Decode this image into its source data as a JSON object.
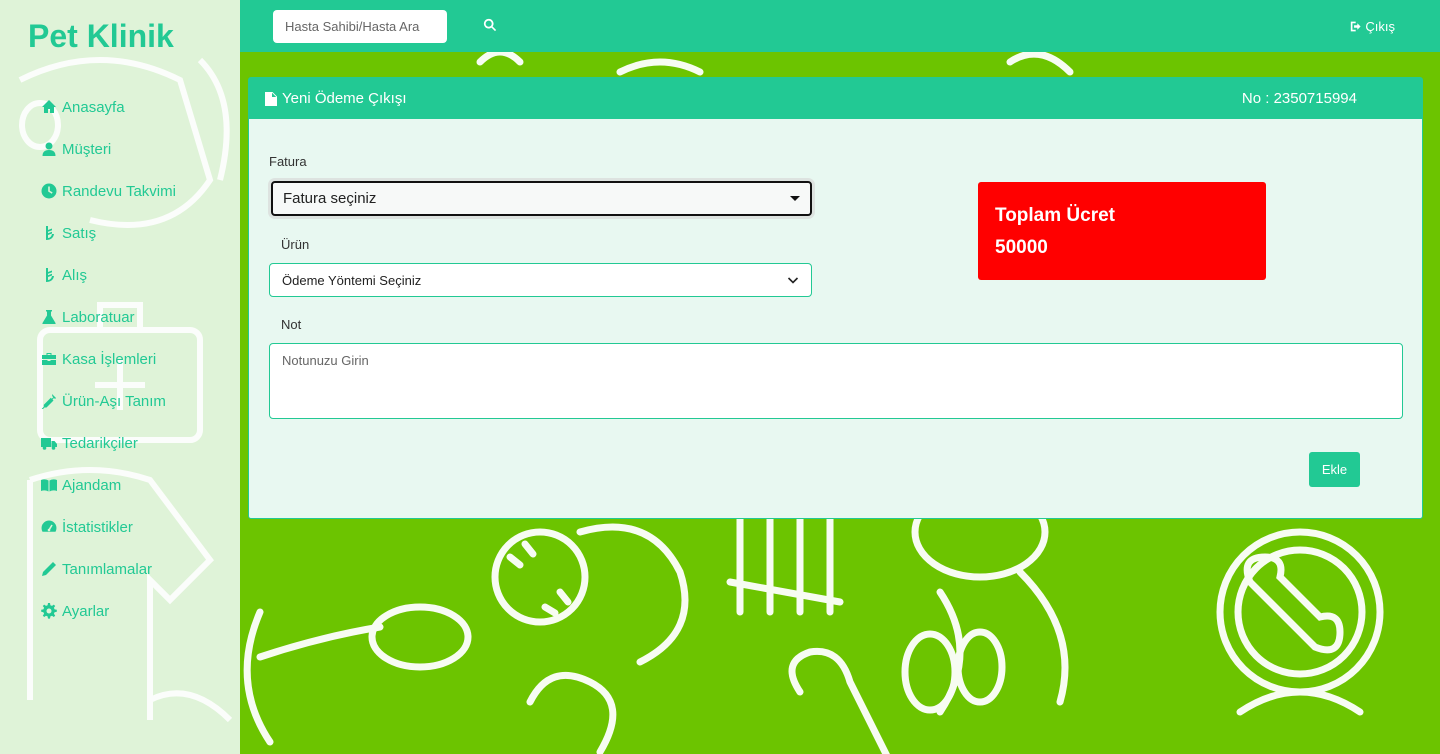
{
  "app": {
    "brand": "Pet Klinik"
  },
  "sidebar": {
    "items": [
      {
        "label": "Anasayfa",
        "icon": "home-icon"
      },
      {
        "label": "Müşteri",
        "icon": "user-icon"
      },
      {
        "label": "Randevu Takvimi",
        "icon": "clock-icon"
      },
      {
        "label": "Satış",
        "icon": "lira-icon"
      },
      {
        "label": "Alış",
        "icon": "lira-icon"
      },
      {
        "label": "Laboratuar",
        "icon": "flask-icon"
      },
      {
        "label": "Kasa İşlemleri",
        "icon": "briefcase-icon"
      },
      {
        "label": "Ürün-Aşı Tanım",
        "icon": "syringe-icon"
      },
      {
        "label": "Tedarikçiler",
        "icon": "truck-icon"
      },
      {
        "label": "Ajandam",
        "icon": "book-icon"
      },
      {
        "label": "İstatistikler",
        "icon": "gauge-icon"
      },
      {
        "label": "Tanımlamalar",
        "icon": "pencil-icon"
      },
      {
        "label": "Ayarlar",
        "icon": "gear-icon"
      }
    ]
  },
  "topbar": {
    "search_placeholder": "Hasta Sahibi/Hasta Ara",
    "logout_label": "Çıkış"
  },
  "card": {
    "title": "Yeni Ödeme Çıkışı",
    "number": "No : 2350715994",
    "fatura_label": "Fatura",
    "fatura_value": "Fatura seçiniz",
    "urun_label": "Ürün",
    "urun_value": "Ödeme Yöntemi Seçiniz",
    "not_label": "Not",
    "not_placeholder": "Notunuzu Girin",
    "total_label": "Toplam Ücret",
    "total_value": "50000",
    "add_label": "Ekle"
  },
  "colors": {
    "accent": "#22c994",
    "background": "#6cc400",
    "total_bg": "#ff0000"
  }
}
